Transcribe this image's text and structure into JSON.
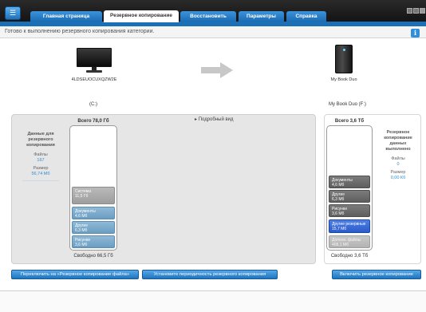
{
  "tabs": {
    "home": "Главная страница",
    "backup": "Резервное копирование",
    "restore": "Восстановить",
    "settings": "Параметры",
    "help": "Справка"
  },
  "status": {
    "text": "Готово к выполнению резервного копирования категории.",
    "info_icon": "info-icon"
  },
  "source": {
    "device_name": "4LDSEUOCUXQZW2E",
    "drive": "(C:)",
    "total": "Всего 78,0 Гб",
    "free": "Свободно 66,5 Гб",
    "info_title": "Данные для резервного копирования",
    "files_label": "Файлы",
    "files_value": "167",
    "size_label": "Размер",
    "size_value": "56,74 Мб",
    "segments": [
      {
        "label": "Система",
        "value": "11,5 Гб"
      },
      {
        "label": "Документы",
        "value": "4,6 Мб"
      },
      {
        "label": "Другие",
        "value": "6,3 Мб"
      },
      {
        "label": "Рисунки",
        "value": "3,6 Мб"
      }
    ]
  },
  "target": {
    "device_name": "My Book Duo",
    "drive": "My Book Duo (F:)",
    "total": "Всего 3,6 Тб",
    "free": "Свободно 3,6 Тб",
    "info_title": "Резервное копирование данных выполнено",
    "files_label": "Файлы",
    "files_value": "0",
    "size_label": "Размер",
    "size_value": "0,00 Кб",
    "segments": [
      {
        "label": "Документы",
        "value": "4,6 Мб"
      },
      {
        "label": "Другие",
        "value": "6,3 Мб"
      },
      {
        "label": "Рисунки",
        "value": "3,6 Мб"
      },
      {
        "label": "Другие резервные",
        "value": "15,7 Мб"
      },
      {
        "label": "Дополн. файлы",
        "value": "408,1 Мб"
      }
    ]
  },
  "detail_link": "Подробный вид",
  "buttons": {
    "switch_file_backup": "Переключить на «Резервное копирование файла»",
    "set_frequency": "Установите периодичность резервного копирования",
    "enable_backup": "Включить резервное копирование"
  },
  "colors": {
    "accent": "#1f74bd",
    "segment_blue": "#6b9dc2",
    "segment_gray": "#9e9e9e",
    "segment_dark": "#5e5e5e",
    "segment_highlight": "#2b5bc8"
  }
}
